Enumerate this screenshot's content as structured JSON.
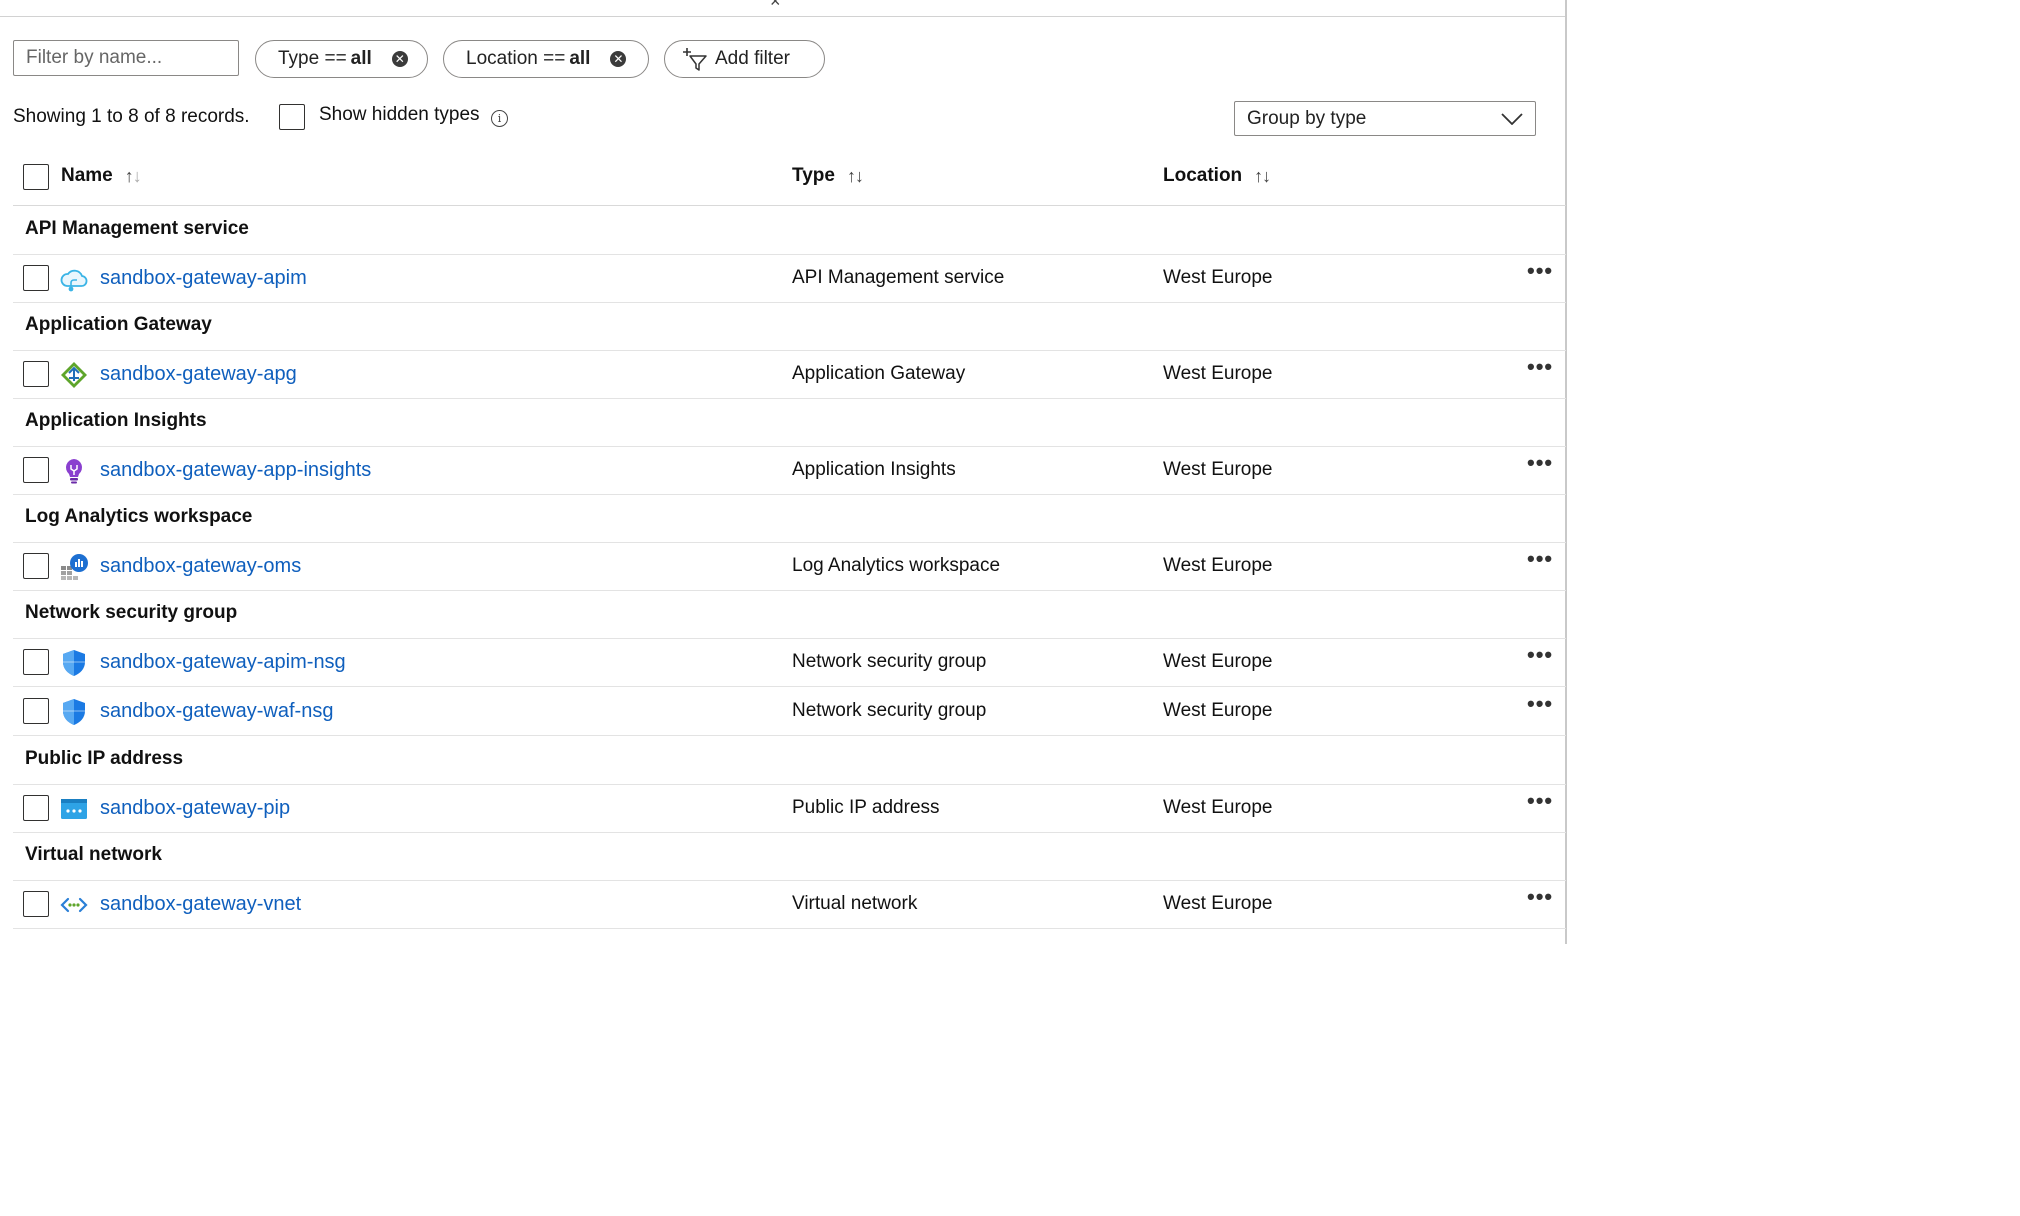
{
  "top": {
    "close_glyph": "×"
  },
  "filters": {
    "name_placeholder": "Filter by name...",
    "type_key": "Type ==",
    "type_value": "all",
    "location_key": "Location ==",
    "location_value": "all",
    "add_filter_label": "Add filter"
  },
  "summary": {
    "records_text": "Showing 1 to 8 of 8 records.",
    "show_hidden_label": "Show hidden types",
    "info_glyph": "i",
    "group_by_value": "Group by type"
  },
  "columns": {
    "name": "Name",
    "type": "Type",
    "location": "Location"
  },
  "groups": [
    {
      "title": "API Management service",
      "items": [
        {
          "name": "sandbox-gateway-apim",
          "type": "API Management service",
          "location": "West Europe",
          "icon": "api-management-icon"
        }
      ]
    },
    {
      "title": "Application Gateway",
      "items": [
        {
          "name": "sandbox-gateway-apg",
          "type": "Application Gateway",
          "location": "West Europe",
          "icon": "application-gateway-icon"
        }
      ]
    },
    {
      "title": "Application Insights",
      "items": [
        {
          "name": "sandbox-gateway-app-insights",
          "type": "Application Insights",
          "location": "West Europe",
          "icon": "application-insights-icon"
        }
      ]
    },
    {
      "title": "Log Analytics workspace",
      "items": [
        {
          "name": "sandbox-gateway-oms",
          "type": "Log Analytics workspace",
          "location": "West Europe",
          "icon": "log-analytics-icon"
        }
      ]
    },
    {
      "title": "Network security group",
      "items": [
        {
          "name": "sandbox-gateway-apim-nsg",
          "type": "Network security group",
          "location": "West Europe",
          "icon": "network-security-group-icon"
        },
        {
          "name": "sandbox-gateway-waf-nsg",
          "type": "Network security group",
          "location": "West Europe",
          "icon": "network-security-group-icon"
        }
      ]
    },
    {
      "title": "Public IP address",
      "items": [
        {
          "name": "sandbox-gateway-pip",
          "type": "Public IP address",
          "location": "West Europe",
          "icon": "public-ip-icon"
        }
      ]
    },
    {
      "title": "Virtual network",
      "items": [
        {
          "name": "sandbox-gateway-vnet",
          "type": "Virtual network",
          "location": "West Europe",
          "icon": "virtual-network-icon"
        }
      ]
    }
  ],
  "row_more_glyph": "•••",
  "colors": {
    "link": "#0f5fbd",
    "border": "#8a8886",
    "apim": "#3ab4e6",
    "appgw": "#5ea52b",
    "insights": "#8a3fcf",
    "analytics": "#1d6fd1",
    "nsg": "#1b7ae3",
    "pip": "#2ea3e6",
    "vnet": "#2a7fd6"
  }
}
